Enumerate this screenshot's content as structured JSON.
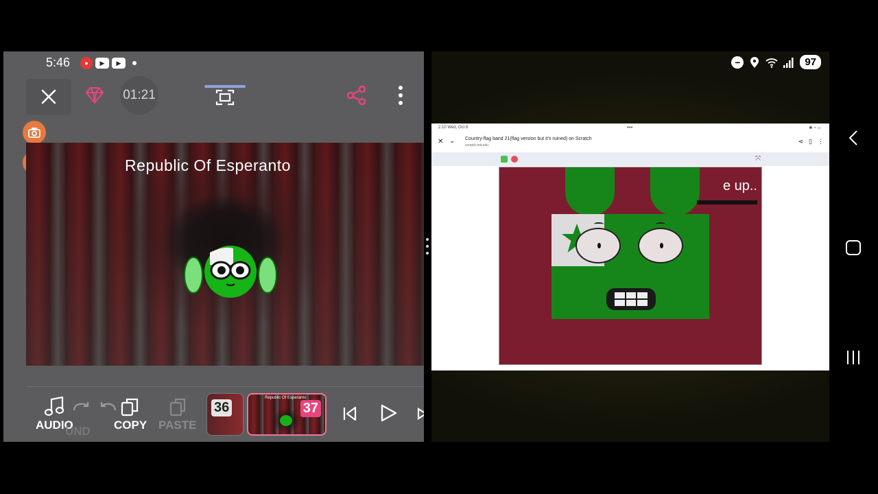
{
  "left": {
    "status": {
      "time": "5:46"
    },
    "toolbar": {
      "timer": "01:21"
    },
    "preview": {
      "title": "Republic Of Esperanto"
    },
    "bottom": {
      "audio_label": "AUDIO",
      "undo_label": "UND",
      "copy_label": "COPY",
      "paste_label": "PASTE"
    },
    "frames": [
      {
        "number": "36"
      },
      {
        "number": "37",
        "caption": "Republic Of Esperanto"
      }
    ]
  },
  "right": {
    "status": {
      "battery": "97"
    },
    "tablet": {
      "time": "2:10  Wed, Oct 8",
      "dots": "•••",
      "page_title": "Country-flag band 21(flag version but it's ruined) on Scratch",
      "url": "scratch.mit.edu",
      "speech": "e up.."
    }
  },
  "colors": {
    "accent_pink": "#e8457c",
    "flag_green": "#17861a",
    "stage_red": "#7b1d2e"
  }
}
